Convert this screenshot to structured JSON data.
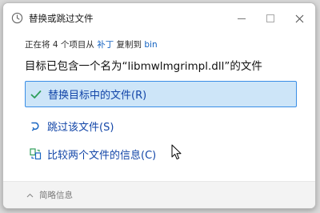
{
  "window": {
    "title": "替换或跳过文件"
  },
  "info": {
    "prefix": "正在将 4 个项目从",
    "source": "补丁",
    "middle": "复制到",
    "destination": "bin"
  },
  "heading": "目标已包含一个名为“libmwlmgrimpl.dll”的文件",
  "options": [
    {
      "label": "替换目标中的文件(R)",
      "icon": "checkmark-icon"
    },
    {
      "label": "跳过该文件(S)",
      "icon": "skip-icon"
    },
    {
      "label": "比较两个文件的信息(C)",
      "icon": "compare-icon"
    }
  ],
  "footer": {
    "details_label": "简略信息"
  },
  "colors": {
    "accent": "#1346a8",
    "selected_bg": "#cde5f8",
    "selected_border": "#3a8ee6",
    "check": "#2e9e5a"
  }
}
